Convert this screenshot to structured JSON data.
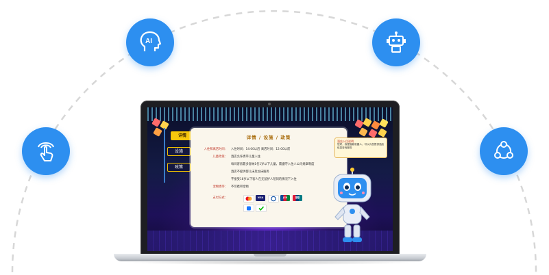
{
  "colors": {
    "accent": "#2d8ff0",
    "tab_active": "#f7c80d",
    "panel": "#faf6ec",
    "label_red": "#c0392b"
  },
  "features": [
    {
      "name": "ai-head-icon",
      "label": "AI"
    },
    {
      "name": "robot-icon"
    },
    {
      "name": "touch-gesture-icon"
    },
    {
      "name": "share-network-icon"
    }
  ],
  "app": {
    "tabs": [
      "详情",
      "设施",
      "政策"
    ],
    "panel_title": "详情 / 设施 / 政策",
    "rows": [
      {
        "label": "入住和离店时间：",
        "value": "入住时间：14:00以后   离店时间：12:00以前"
      },
      {
        "label": "儿童政策：",
        "value": "酒店允许携带儿童入住"
      },
      {
        "label": "",
        "value": "每间客房最多容纳1名1岁以下儿童，需遵守入住人公司规章制度"
      },
      {
        "label": "",
        "value": "酒店不提供婴儿床及加床服务"
      },
      {
        "label": "",
        "value": "不接受18岁以下客人在无监护人陪同的情况下入住"
      },
      {
        "label": "宠物携带：",
        "value": "不可携带宠物"
      }
    ],
    "payment_label": "支付方式：",
    "cards": [
      "VISA",
      "JCB",
      "银联"
    ],
    "bubble_title": "酒店入住说明",
    "bubble_text": "您好，我是智能机器人，可以为您提供酒店信息查询服务"
  }
}
